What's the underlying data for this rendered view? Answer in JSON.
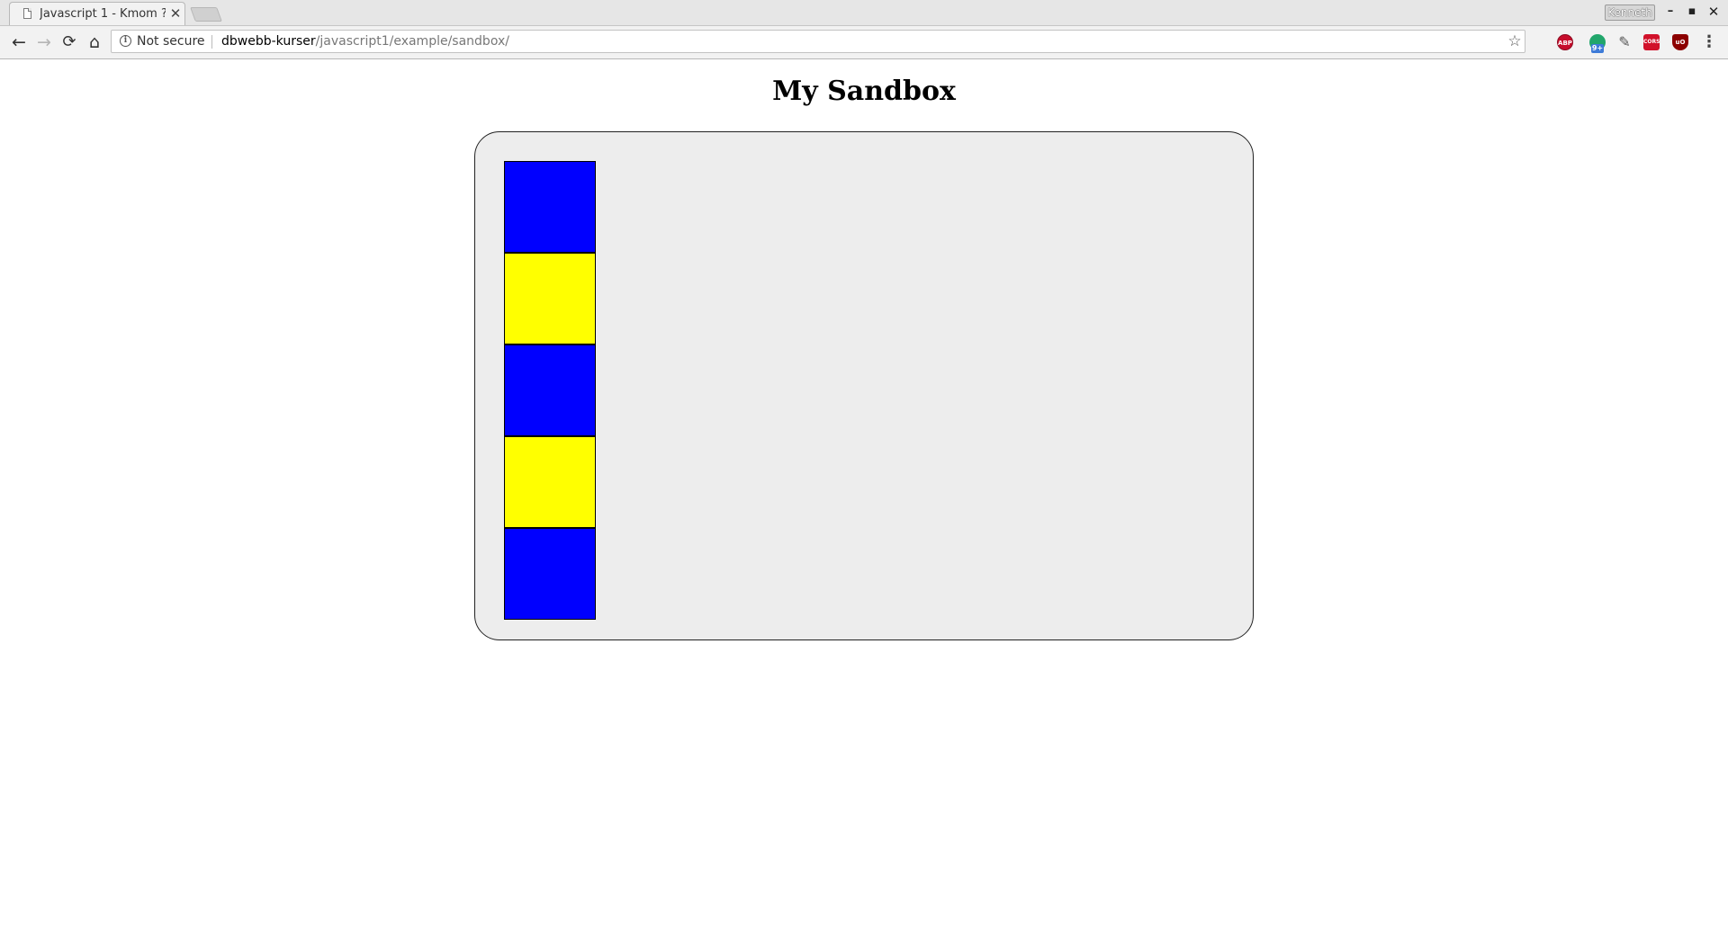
{
  "browser": {
    "tab": {
      "title": "Javascript 1 - Kmom ?",
      "close_glyph": "✕"
    },
    "profile_name": "Kenneth",
    "window_controls": {
      "minimize": "–",
      "maximize": "▪",
      "close": "✕"
    },
    "toolbar": {
      "back_glyph": "←",
      "forward_glyph": "→",
      "reload_glyph": "⟳",
      "home_glyph": "⌂",
      "security_label": "Not secure",
      "url_host": "dbwebb-kurser",
      "url_path": "/javascript1/example/sandbox/",
      "bookmark_glyph": "☆",
      "menu_glyph": "⋮"
    },
    "extensions": [
      {
        "name": "adblock-plus-icon",
        "label": "ABP"
      },
      {
        "name": "grammarly-icon",
        "badge": "9+"
      },
      {
        "name": "color-picker-icon"
      },
      {
        "name": "cors-icon",
        "label": "CORS"
      },
      {
        "name": "ublock-icon",
        "label": "uO"
      }
    ]
  },
  "page": {
    "heading": "My Sandbox",
    "boxes": [
      {
        "color": "#0000ff"
      },
      {
        "color": "#ffff00"
      },
      {
        "color": "#0000ff"
      },
      {
        "color": "#ffff00"
      },
      {
        "color": "#0000ff"
      }
    ]
  },
  "colors": {
    "sandbox_background": "#ededed",
    "blue": "#0000ff",
    "yellow": "#ffff00"
  }
}
